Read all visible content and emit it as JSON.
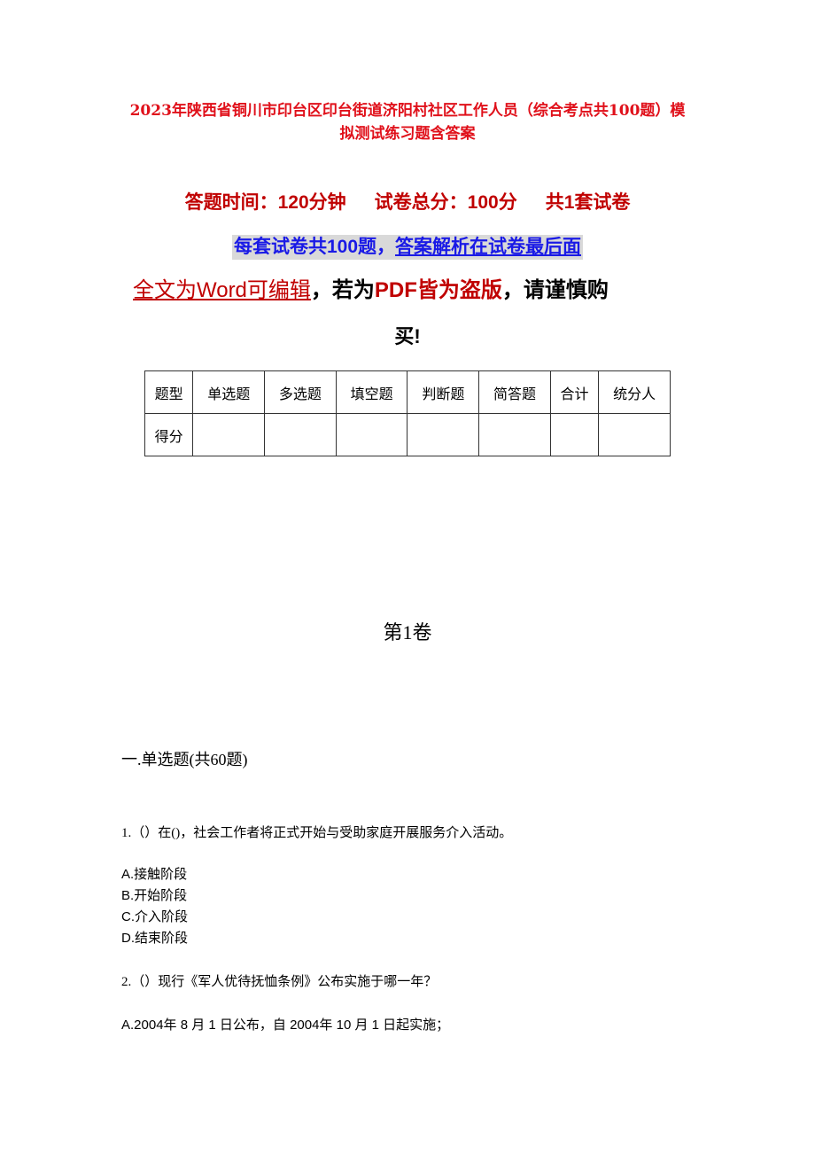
{
  "document": {
    "title": "2023年陕西省铜川市印台区印台街道济阳村社区工作人员（综合考点共100题）模拟测试练习题含答案",
    "meta": {
      "time": "答题时间：120分钟",
      "total_score": "试卷总分：100分",
      "sets": "共1套试卷"
    },
    "notice": {
      "part1": "每套试卷共100题，",
      "part2": "答案解析在试卷最后面"
    },
    "editable_notice": {
      "part1": "全文为Word可编辑",
      "comma1": "，",
      "part2": "若为",
      "part3": "PDF皆为盗版",
      "comma2": "，",
      "part4": "请谨慎购",
      "part5": "买!"
    },
    "score_table": {
      "header": [
        "题型",
        "单选题",
        "多选题",
        "填空题",
        "判断题",
        "简答题",
        "合计",
        "统分人"
      ],
      "row": [
        "得分",
        "",
        "",
        "",
        "",
        "",
        "",
        ""
      ]
    },
    "volume_title": "第1卷",
    "section_title": "一.单选题(共60题)",
    "questions": [
      {
        "text": "1.（）在()，社会工作者将正式开始与受助家庭开展服务介入活动。",
        "options": [
          "A.接触阶段",
          "B.开始阶段",
          "C.介入阶段",
          "D.结束阶段"
        ]
      },
      {
        "text": "2.（）现行《军人优待抚恤条例》公布实施于哪一年？",
        "options": [
          "A.2004年 8 月 1 日公布，自 2004年 10 月 1 日起实施；"
        ]
      }
    ]
  }
}
